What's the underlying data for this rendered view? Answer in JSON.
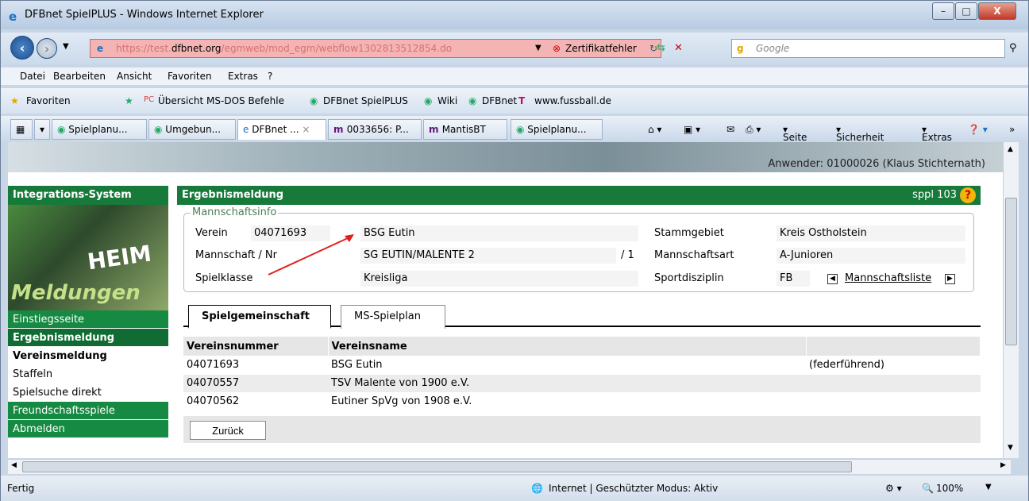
{
  "window": {
    "title": "DFBnet SpielPLUS - Windows Internet Explorer",
    "buttons": {
      "min": "–",
      "max": "□",
      "close": "X"
    }
  },
  "address": {
    "url_prefix": "https://test.",
    "url_host": "dfbnet.org",
    "url_path": "/egmweb/mod_egm/webflow1302813512854.do",
    "cert_error": "Zertifikatfehler",
    "search_placeholder": "Google"
  },
  "menu": {
    "items": [
      "Datei",
      "Bearbeiten",
      "Ansicht",
      "Favoriten",
      "Extras",
      "?"
    ]
  },
  "favorites": {
    "label": "Favoriten",
    "links": [
      "Übersicht MS-DOS Befehle",
      "DFBnet SpielPLUS",
      "Wiki",
      "DFBnet",
      "www.fussball.de"
    ]
  },
  "tabs": [
    {
      "label": "Spielplanu..."
    },
    {
      "label": "Umgebun..."
    },
    {
      "label": "DFBnet ..."
    },
    {
      "label": "0033656: P..."
    },
    {
      "label": "MantisBT"
    },
    {
      "label": "Spielplanu..."
    }
  ],
  "commands": {
    "page": "Seite",
    "security": "Sicherheit",
    "extras": "Extras"
  },
  "page": {
    "user": "Anwender: 01000026 (Klaus Stichternath)",
    "nav": {
      "header": "Integrations-System",
      "heim": "HEIM",
      "meldungen": "Meldungen",
      "items": [
        "Einstiegsseite",
        "Ergebnismeldung",
        "Vereinsmeldung",
        "Staffeln",
        "Spielsuche direkt",
        "Freundschaftsspiele",
        "Abmelden"
      ]
    },
    "header": {
      "title": "Ergebnismeldung",
      "code": "sppl 103",
      "help": "?"
    },
    "team_info": {
      "legend": "Mannschaftsinfo",
      "verein_label": "Verein",
      "verein_nr": "04071693",
      "verein_name": "BSG Eutin",
      "mannschaft_label": "Mannschaft / Nr",
      "mannschaft_name": "SG EUTIN/MALENTE 2",
      "mannschaft_nr": "/ 1",
      "spielklasse_label": "Spielklasse",
      "spielklasse": "Kreisliga",
      "stammgebiet_label": "Stammgebiet",
      "stammgebiet": "Kreis Ostholstein",
      "mannschaftsart_label": "Mannschaftsart",
      "mannschaftsart": "A-Junioren",
      "sportdisziplin_label": "Sportdisziplin",
      "sportdisziplin": "FB",
      "list_link": "Mannschaftsliste"
    },
    "tabs": [
      "Spielgemeinschaft",
      "MS-Spielplan"
    ],
    "table": {
      "headers": [
        "Vereinsnummer",
        "Vereinsname",
        ""
      ],
      "rows": [
        [
          "04071693",
          "BSG Eutin",
          "(federführend)"
        ],
        [
          "04070557",
          "TSV Malente von 1900 e.V.",
          ""
        ],
        [
          "04070562",
          "Eutiner SpVg von 1908 e.V.",
          ""
        ]
      ]
    },
    "back_button": "Zurück"
  },
  "status": {
    "text": "Fertig",
    "zone": "Internet | Geschützter Modus: Aktiv",
    "zoom": "100%"
  }
}
